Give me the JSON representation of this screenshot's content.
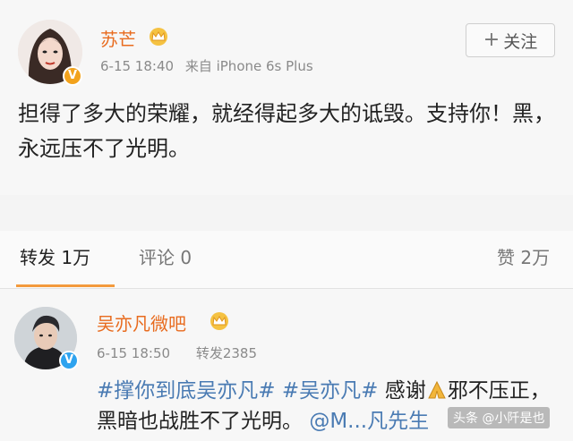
{
  "post": {
    "author": "苏芒",
    "time": "6-15 18:40",
    "source": "来自 iPhone 6s Plus",
    "follow_label": "关注",
    "text": "担得了多大的荣耀，就经得起多大的诋毁。支持你！黑，永远压不了光明。"
  },
  "tabs": {
    "repost": "转发 1万",
    "comment": "评论 0",
    "like": "赞 2万"
  },
  "comment": {
    "author": "吴亦凡微吧",
    "time": "6-15 18:50",
    "reposts": "转发2385",
    "hashtag1": "#撑你到底吴亦凡#",
    "hashtag2": "#吴亦凡#",
    "text_part1": " 感谢",
    "text_part2": "邪不压正，黑暗也战胜不了光明。",
    "mention": "@M...凡先生"
  },
  "watermark": "头条 @小阡是也"
}
